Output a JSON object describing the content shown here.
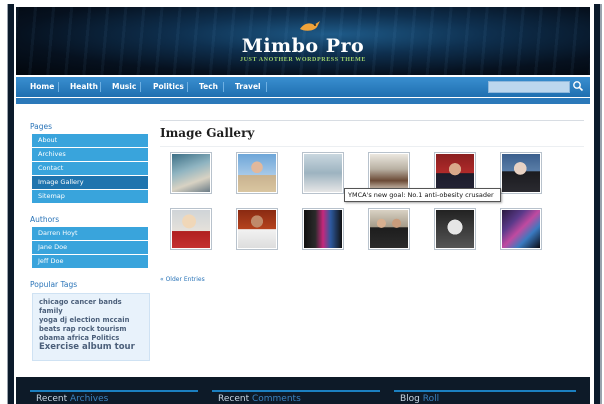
{
  "header": {
    "title": "Mimbo Pro",
    "tagline": "JUST ANOTHER WORDPRESS THEME",
    "logo_icon": "bird-icon"
  },
  "nav": {
    "items": [
      {
        "label": "Home"
      },
      {
        "label": "Health"
      },
      {
        "label": "Music"
      },
      {
        "label": "Politics"
      },
      {
        "label": "Tech"
      },
      {
        "label": "Travel"
      }
    ],
    "search": {
      "value": "",
      "placeholder": ""
    },
    "search_icon": "search-icon"
  },
  "sidebar": {
    "pages_heading": "Pages",
    "pages": [
      {
        "label": "About"
      },
      {
        "label": "Archives"
      },
      {
        "label": "Contact"
      },
      {
        "label": "Image Gallery"
      },
      {
        "label": "Sitemap"
      }
    ],
    "authors_heading": "Authors",
    "authors": [
      {
        "label": "Darren Hoyt"
      },
      {
        "label": "Jane Doe"
      },
      {
        "label": "Jeff Doe"
      }
    ],
    "tags_heading": "Popular Tags",
    "tags_line1": "chicago cancer bands family",
    "tags_line2": "yoga dj election mccain",
    "tags_line3": "beats rap rock tourism",
    "tags_line4": "obama africa Politics",
    "tags_big1": "Exercise",
    "tags_big2": "album",
    "tags_big3": "tour"
  },
  "main": {
    "title": "Image Gallery",
    "tooltip": "YMCA's new goal: No.1 anti-obesity crusader",
    "older_entries": "« Older Entries"
  },
  "footer": {
    "col1_a": "Recent",
    "col1_b": " Archives",
    "col2_a": "Recent",
    "col2_b": " Comments",
    "col3_a": "Blog",
    "col3_b": " Roll"
  },
  "colors": {
    "nav_blue": "#2f86c8",
    "side_item": "#39a4dc",
    "side_active": "#1f74ae",
    "link": "#2a74b8",
    "tagline": "#9fd16c"
  }
}
